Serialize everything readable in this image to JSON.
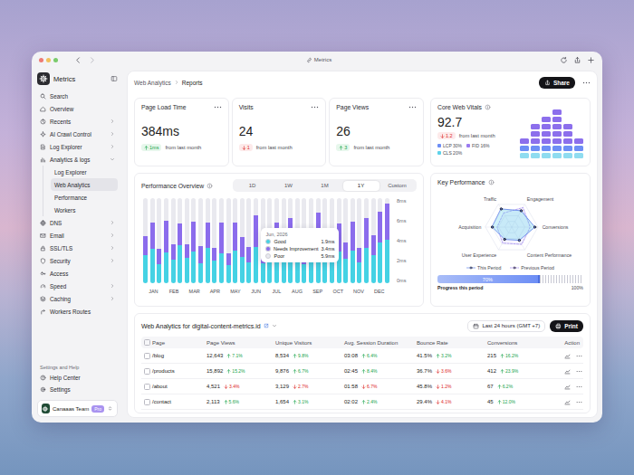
{
  "window": {
    "title": "Metrics"
  },
  "sidebar": {
    "app_name": "Metrics",
    "items": [
      {
        "label": "Search",
        "selected": false,
        "expandable": false,
        "expanded": false
      },
      {
        "label": "Overview",
        "selected": false,
        "expandable": false,
        "expanded": false
      },
      {
        "label": "Recents",
        "selected": false,
        "expandable": true,
        "expanded": false
      },
      {
        "label": "AI Crawl Control",
        "selected": false,
        "expandable": true,
        "expanded": false
      },
      {
        "label": "Log Explorer",
        "selected": false,
        "expandable": true,
        "expanded": false
      },
      {
        "label": "Analytics & logs",
        "selected": false,
        "expandable": true,
        "expanded": true,
        "children": [
          {
            "label": "Log Explorer",
            "selected": false
          },
          {
            "label": "Web Analytics",
            "selected": true
          },
          {
            "label": "Performance",
            "selected": false
          },
          {
            "label": "Workers",
            "selected": false
          }
        ]
      },
      {
        "label": "DNS",
        "selected": false,
        "expandable": true,
        "expanded": false
      },
      {
        "label": "Email",
        "selected": false,
        "expandable": true,
        "expanded": false
      },
      {
        "label": "SSL/TLS",
        "selected": false,
        "expandable": true,
        "expanded": false
      },
      {
        "label": "Security",
        "selected": false,
        "expandable": true,
        "expanded": false
      },
      {
        "label": "Access",
        "selected": false,
        "expandable": false,
        "expanded": false
      },
      {
        "label": "Speed",
        "selected": false,
        "expandable": true,
        "expanded": false
      },
      {
        "label": "Caching",
        "selected": false,
        "expandable": true,
        "expanded": false
      },
      {
        "label": "Workers Routes",
        "selected": false,
        "expandable": false,
        "expanded": false
      }
    ],
    "settings_heading": "Settings and Help",
    "settings_items": [
      "Help Center",
      "Settings"
    ],
    "team": {
      "name": "Canaaas Team",
      "badge": "Pro"
    }
  },
  "breadcrumb": [
    "Web Analytics",
    "Reports"
  ],
  "share_button": "Share",
  "stats": [
    {
      "title": "Page Load Time",
      "value": "384ms",
      "change": "1ms",
      "direction": "up",
      "note": "from last month"
    },
    {
      "title": "Visits",
      "value": "24",
      "change": "1",
      "direction": "down",
      "note": "from last month"
    },
    {
      "title": "Page Views",
      "value": "26",
      "change": "3",
      "direction": "up",
      "note": "from last month"
    }
  ],
  "core_web_vitals": {
    "title": "Core Web Vitals",
    "value": "92.7",
    "change": "1.2",
    "direction": "down",
    "note": "from last month",
    "legend": [
      {
        "label": "LCP 30%",
        "color": "#6d8ef5"
      },
      {
        "label": "FID 16%",
        "color": "#9a7bf0"
      },
      {
        "label": "CLS 20%",
        "color": "#5ed2ea"
      }
    ],
    "blocks": {
      "upper": [
        1,
        3,
        4,
        5,
        3,
        1
      ],
      "lower": [
        2,
        2,
        2,
        2,
        2,
        2
      ]
    }
  },
  "performance": {
    "title": "Performance Overview",
    "ranges": [
      {
        "label": "1D",
        "selected": false
      },
      {
        "label": "1W",
        "selected": false
      },
      {
        "label": "1M",
        "selected": false
      },
      {
        "label": "1Y",
        "selected": true
      },
      {
        "label": "Custom",
        "selected": false
      }
    ],
    "y_ticks": [
      "8ms",
      "6ms",
      "4ms",
      "2ms",
      "0ms"
    ],
    "x_labels": [
      "JAN",
      "FEB",
      "MAR",
      "APR",
      "MAY",
      "JUN",
      "JUL",
      "AUG",
      "SEP",
      "OCT",
      "NOV",
      "DEC"
    ],
    "max": 8,
    "series": [
      {
        "name": "Good",
        "color": "#45d2e4",
        "values": [
          2.6,
          3.2,
          1.8,
          2.9,
          2.2,
          3.6,
          2.4,
          3.0,
          1.9,
          3.3,
          2.1,
          2.8,
          1.7,
          3.1,
          2.5,
          2.0,
          3.4,
          1.9,
          2.7,
          3.0,
          2.2,
          3.2,
          2.4,
          1.8,
          2.9,
          3.5,
          2.1,
          2.5,
          3.0,
          2.3,
          3.1,
          2.0,
          3.3,
          2.6,
          3.8,
          4.1
        ]
      },
      {
        "name": "Needs Improvement",
        "color": "#8b6cec",
        "values": [
          1.8,
          2.5,
          1.4,
          3.0,
          1.5,
          2.0,
          1.3,
          2.8,
          1.6,
          2.4,
          1.2,
          2.9,
          1.1,
          2.6,
          1.8,
          1.4,
          3.0,
          1.5,
          2.1,
          2.7,
          1.6,
          2.9,
          1.7,
          1.3,
          2.0,
          3.1,
          1.4,
          1.8,
          2.6,
          1.5,
          2.7,
          1.3,
          2.8,
          1.9,
          2.9,
          3.4
        ]
      },
      {
        "name": "Poor",
        "color": "#e9e9ef",
        "values": [
          3.6,
          2.3,
          4.8,
          2.1,
          4.3,
          2.4,
          4.3,
          2.2,
          4.5,
          2.3,
          4.7,
          2.3,
          5.2,
          2.3,
          3.7,
          4.6,
          1.6,
          4.6,
          3.2,
          2.3,
          4.2,
          1.9,
          3.9,
          4.9,
          3.1,
          1.4,
          4.5,
          3.7,
          2.4,
          4.2,
          2.2,
          4.7,
          1.9,
          3.5,
          1.3,
          0.5
        ]
      }
    ],
    "tooltip": {
      "title": "Jun, 2026",
      "rows": [
        {
          "label": "Good",
          "value": "1.9ms",
          "color": "#45d2e4"
        },
        {
          "label": "Needs Improvement",
          "value": "3.4ms",
          "color": "#8b6cec"
        },
        {
          "label": "Poor",
          "value": "5.9ms",
          "color": "#e9e9ef"
        }
      ]
    }
  },
  "key_performance": {
    "title": "Key Performance",
    "max": 100,
    "axes": [
      {
        "label": "Traffic",
        "this_period": 80,
        "previous_period": 62
      },
      {
        "label": "Engagement",
        "this_period": 72,
        "previous_period": 86
      },
      {
        "label": "Conversions",
        "this_period": 88,
        "previous_period": 70
      },
      {
        "label": "Content Performance",
        "this_period": 58,
        "previous_period": 76
      },
      {
        "label": "User Experience",
        "this_period": 54,
        "previous_period": 70
      },
      {
        "label": "Acquisition",
        "this_period": 74,
        "previous_period": 56
      }
    ],
    "legend": [
      {
        "label": "This Period",
        "color": "#5b7ee9"
      },
      {
        "label": "Previous Period",
        "color": "#9a7bf0"
      }
    ],
    "progress": {
      "label": "Progress this period",
      "level": 0.7,
      "reading": "70%",
      "max_label": "100%"
    }
  },
  "table": {
    "title": "Web Analytics for digital-content-metrics.id",
    "time_range": "Last 24 hours (GMT +7)",
    "print_button": "Print",
    "all_checked": false,
    "columns": [
      "Page",
      "Page Views",
      "Unique Visitors",
      "Avg. Session Duration",
      "Bounce Rate",
      "Conversions",
      "Action"
    ],
    "rows": [
      {
        "page": "/blog",
        "checked": false,
        "cells": [
          {
            "value": "12,643",
            "change": "7.1%",
            "direction": "up"
          },
          {
            "value": "8,534",
            "change": "9.8%",
            "direction": "up"
          },
          {
            "value": "03:08",
            "change": "6.4%",
            "direction": "up"
          },
          {
            "value": "41.5%",
            "change": "3.2%",
            "direction": "up"
          },
          {
            "value": "215",
            "change": "16.2%",
            "direction": "up"
          }
        ]
      },
      {
        "page": "/products",
        "checked": false,
        "cells": [
          {
            "value": "15,892",
            "change": "15.2%",
            "direction": "up"
          },
          {
            "value": "9,876",
            "change": "6.7%",
            "direction": "up"
          },
          {
            "value": "02:45",
            "change": "8.4%",
            "direction": "up"
          },
          {
            "value": "36.7%",
            "change": "3.6%",
            "direction": "down"
          },
          {
            "value": "412",
            "change": "23.9%",
            "direction": "up"
          }
        ]
      },
      {
        "page": "/about",
        "checked": false,
        "cells": [
          {
            "value": "4,521",
            "change": "3.4%",
            "direction": "down"
          },
          {
            "value": "3,129",
            "change": "2.7%",
            "direction": "down"
          },
          {
            "value": "01:58",
            "change": "6.7%",
            "direction": "down"
          },
          {
            "value": "45.8%",
            "change": "1.2%",
            "direction": "down"
          },
          {
            "value": "67",
            "change": "6.2%",
            "direction": "up"
          }
        ]
      },
      {
        "page": "/contact",
        "checked": false,
        "cells": [
          {
            "value": "2,113",
            "change": "5.6%",
            "direction": "up"
          },
          {
            "value": "1,654",
            "change": "3.1%",
            "direction": "up"
          },
          {
            "value": "02:02",
            "change": "2.4%",
            "direction": "up"
          },
          {
            "value": "29.4%",
            "change": "4.1%",
            "direction": "down"
          },
          {
            "value": "45",
            "change": "12.0%",
            "direction": "up"
          }
        ]
      }
    ]
  }
}
